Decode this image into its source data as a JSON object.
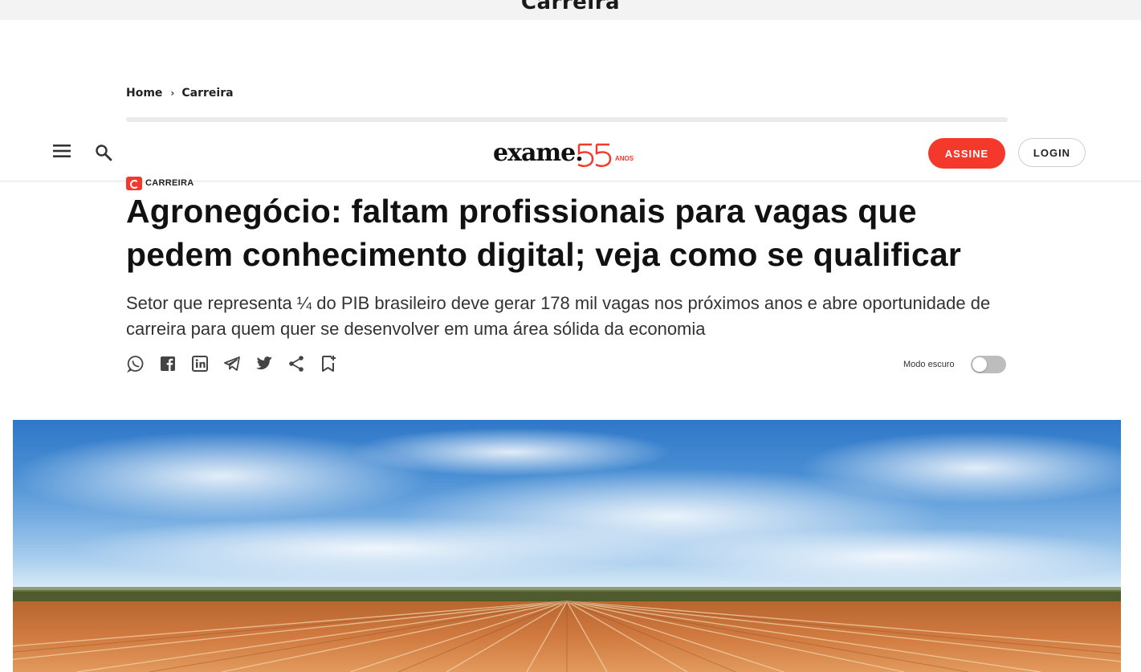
{
  "top_banner": {
    "title": "Carreira"
  },
  "breadcrumb": {
    "items": [
      "Home",
      "Carreira"
    ]
  },
  "header": {
    "logo_text": "exame.",
    "logo_badge": "ANOS",
    "subscribe_label": "ASSINE",
    "login_label": "LOGIN"
  },
  "article": {
    "category": "CARREIRA",
    "headline": "Agronegócio: faltam profissionais para vagas que pedem conhecimento digital; veja como se qualificar",
    "subtitle": "Setor que representa ¼ do PIB brasileiro deve gerar 178 mil vagas nos próximos anos e abre oportunidade de carreira para quem quer se desenvolver em uma área sólida da economia"
  },
  "share_icons": [
    "whatsapp-icon",
    "facebook-icon",
    "linkedin-icon",
    "telegram-icon",
    "twitter-icon",
    "share-icon",
    "bookmark-icon"
  ],
  "dark_mode": {
    "label": "Modo escuro",
    "enabled": false
  },
  "colors": {
    "accent": "#f4382b",
    "text": "#111111",
    "sky": "#4a8fd4",
    "soil": "#c8703c"
  }
}
